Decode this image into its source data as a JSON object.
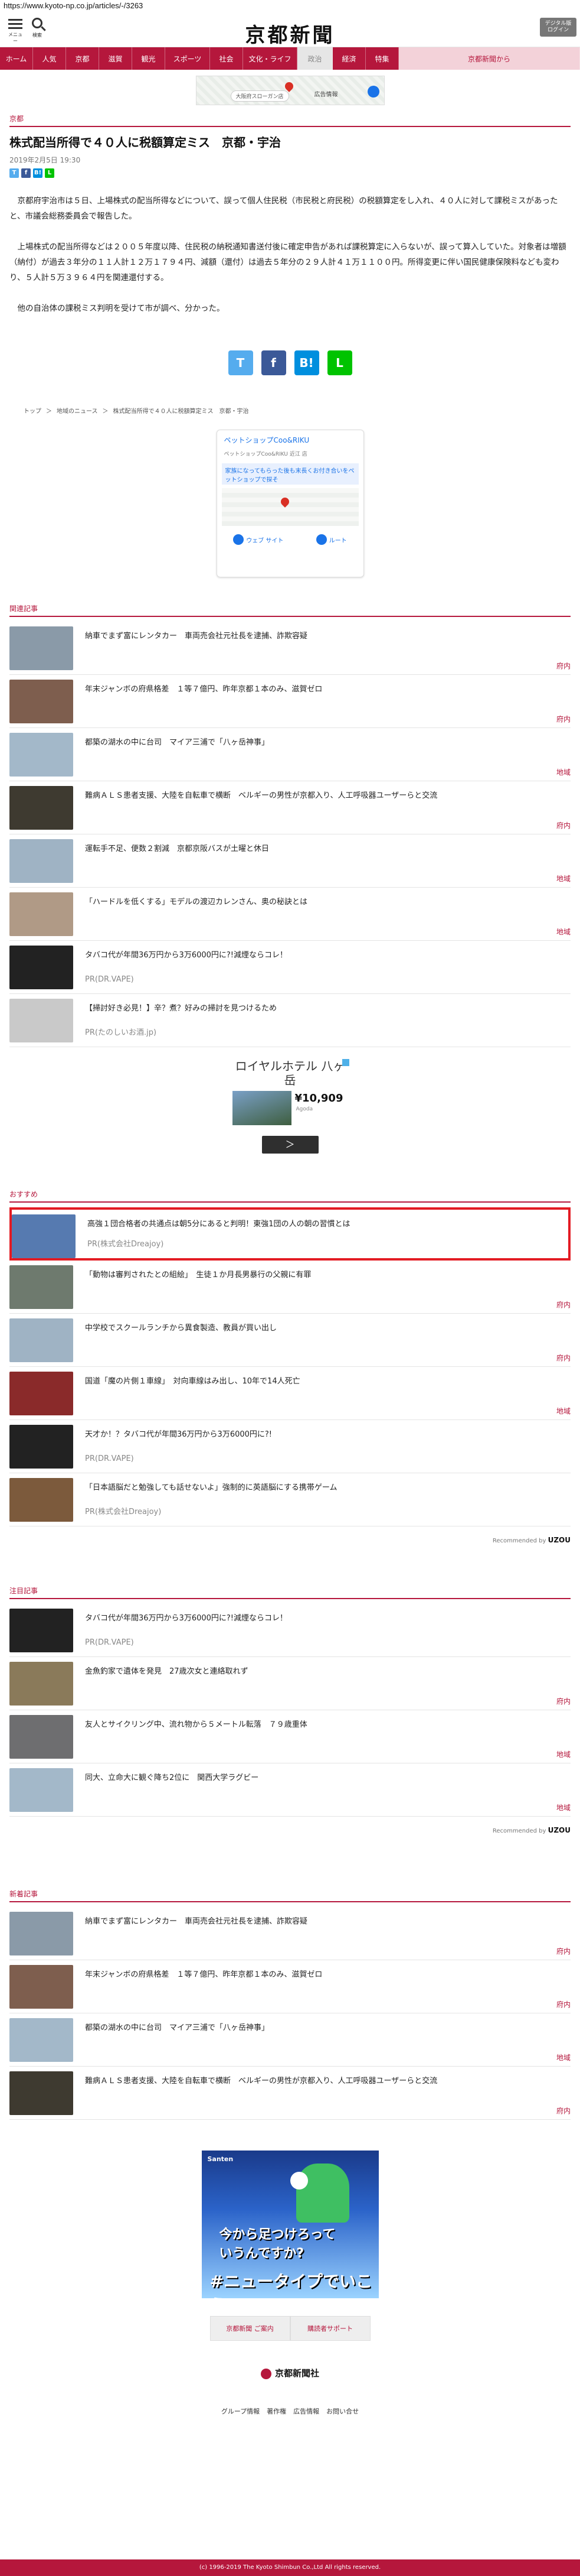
{
  "url": "https://www.kyoto-np.co.jp/articles/-/3263",
  "header": {
    "menu_label": "メニュー",
    "search_label": "検索",
    "logo": "京都新聞",
    "digital_button": "デジタル版 ログイン"
  },
  "nav": {
    "items": [
      "ホーム",
      "人気",
      "京都",
      "滋賀",
      "観光",
      "スポーツ",
      "社会",
      "文化・ライフ",
      "政治",
      "経済",
      "特集",
      "京都新聞から"
    ],
    "active_index": 8
  },
  "top_ad": {
    "badge": "大阪府スローガン店",
    "text": "広告情報"
  },
  "article": {
    "section": "京都",
    "title": "株式配当所得で４０人に税額算定ミス　京都・宇治",
    "date": "2019年2月5日 19:30",
    "paragraphs": [
      "京都府宇治市は５日、上場株式の配当所得などについて、誤って個人住民税（市民税と府民税）の税額算定をし入れ、４０人に対して課税ミスがあったと、市議会総務委員会で報告した。",
      "上場株式の配当所得などは２００５年度以降、住民税の納税通知書送付後に確定申告があれば課税算定に入らないが、誤って算入していた。対象者は増額（納付）が過去３年分の１１人計１２万１７９４円、減額（還付）は過去５年分の２９人計４１万１１００円。所得変更に伴い国民健康保険料なども変わり、５人計５万３９６４円を関連還付する。",
      "他の自治体の課税ミス判明を受けて市が調べ、分かった。"
    ],
    "share_small": [
      "T",
      "f",
      "B!",
      "L"
    ],
    "share_big": [
      "T",
      "f",
      "B!",
      "L"
    ]
  },
  "breadcrumb": [
    "トップ",
    "＞",
    "地域のニュース",
    "＞",
    "株式配当所得で４０人に税額算定ミス　京都・宇治"
  ],
  "map_ad": {
    "name": "ペットショップCoo&RIKU",
    "sub": "ペットショップCoo&RIKU 近江 店",
    "blue_text": "家族になってもらった後も末長くお付き合いをペットショップで探そ",
    "btn_web": "ウェブ サイト",
    "btn_route": "ルート"
  },
  "related": {
    "label": "関連記事",
    "items": [
      {
        "title": "納車でまず富にレンタカー　車両売会社元社長を逮捕、詐欺容疑",
        "category": "府内",
        "thumb": "#8a9aa8"
      },
      {
        "title": "年末ジャンボの府県格差　１等７億円、昨年京都１本のみ、滋賀ゼロ",
        "category": "府内",
        "thumb": "#7e5e4e"
      },
      {
        "title": "都築の湖水の中に台司　マイア三浦で「八ヶ岳神事」",
        "category": "地域",
        "thumb": "#a3b8c9"
      },
      {
        "title": "難病ＡＬＳ患者支援、大陸を自転車で横断　ベルギーの男性が京都入り、人工呼吸器ユーザーらと交流",
        "category": "府内",
        "thumb": "#3e3a30"
      },
      {
        "title": "運転手不足、便数２割減　京都京阪バスが土曜と休日",
        "category": "地域",
        "thumb": "#9fb3c4"
      },
      {
        "title": "「ハードルを低くする」モデルの渡辺カレンさん、奥の秘訣とは",
        "category": "地域",
        "thumb": "#b09a86"
      },
      {
        "title": "タバコ代が年間36万円から3万6000円に?!減煙ならコレ！",
        "pr": "PR(DR.VAPE)",
        "thumb": "#222222"
      },
      {
        "title": "【掃討好き必見！】辛？煮？好みの掃討を見つけるため",
        "pr": "PR(たのしいお酒.jp)",
        "thumb": "#c9c9c9"
      }
    ]
  },
  "hotel_ad": {
    "name": "ロイヤルホテル 八ヶ岳",
    "price": "¥10,909",
    "src": "Agoda",
    "go": "＞"
  },
  "recommend": {
    "label": "おすすめ",
    "items": [
      {
        "title": "高強１団合格者の共通点は朝5分にあると判明！東強1団の人の朝の習慣とは",
        "pr": "PR(株式会社Dreajoy)",
        "thumb": "#567ab0",
        "highlight": true
      },
      {
        "title": "「動物は審判されたとの組絵」　生徒１か月長男暴行の父親に有罪",
        "category": "府内",
        "thumb": "#6e7a6e"
      },
      {
        "title": "中学校でスクールランチから異食製造、教員が買い出し",
        "category": "府内",
        "thumb": "#9fb3c4"
      },
      {
        "title": "国道「魔の片側１車線」　対向車線はみ出し、10年で14人死亡",
        "category": "地域",
        "thumb": "#8a2a2a"
      },
      {
        "title": "天才か！？タバコ代が年間36万円から3万6000円に?!",
        "pr": "PR(DR.VAPE)",
        "thumb": "#222222"
      },
      {
        "title": "「日本語脳だと勉強しても話せないよ」強制的に英語脳にする携帯ゲーム",
        "pr": "PR(株式会社Dreajoy)",
        "thumb": "#7c5a3c"
      }
    ],
    "credit_prefix": "Recommended by",
    "credit_brand": "UZOU"
  },
  "attention": {
    "label": "注目記事",
    "items": [
      {
        "title": "タバコ代が年間36万円から3万6000円に?!減煙ならコレ！",
        "pr": "PR(DR.VAPE)",
        "thumb": "#222222"
      },
      {
        "title": "金魚釣家で遺体を発見　27歳次女と連絡取れず",
        "category": "府内",
        "thumb": "#8a7a5a"
      },
      {
        "title": "友人とサイクリング中、流れ物から５メートル転落　７９歳重体",
        "category": "地域",
        "thumb": "#6e6e70"
      },
      {
        "title": "同大、立命大に観ぐ降ち2位に　関西大学ラグビー",
        "category": "地域",
        "thumb": "#a3b8c9"
      }
    ],
    "credit_prefix": "Recommended by",
    "credit_brand": "UZOU"
  },
  "latest": {
    "label": "新着記事",
    "items": [
      {
        "title": "納車でまず富にレンタカー　車両売会社元社長を逮捕、詐欺容疑",
        "category": "府内",
        "thumb": "#8a9aa8"
      },
      {
        "title": "年末ジャンボの府県格差　１等７億円、昨年京都１本のみ、滋賀ゼロ",
        "category": "府内",
        "thumb": "#7e5e4e"
      },
      {
        "title": "都築の湖水の中に台司　マイア三浦で「八ヶ岳神事」",
        "category": "地域",
        "thumb": "#a3b8c9"
      },
      {
        "title": "難病ＡＬＳ患者支援、大陸を自転車で横断　ベルギーの男性が京都入り、人工呼吸器ユーザーらと交流",
        "category": "府内",
        "thumb": "#3e3a30"
      }
    ]
  },
  "big_ad": {
    "brand": "Santen",
    "line1": "今から足つけろって",
    "line2": "いうんですか?",
    "line3": "#ニュータイプでいこう"
  },
  "footer": {
    "buttons": [
      "京都新聞 ご案内",
      "購読者サポート"
    ],
    "logo": "京都新聞社",
    "links": [
      "グループ情報",
      "著作権",
      "広告情報",
      "お問い合せ"
    ],
    "copyright": "(c) 1996-2019 The Kyoto Shimbun Co.,Ltd All rights reserved."
  },
  "colors": {
    "brand": "#b5173c",
    "highlight_border": "#e31b23",
    "twitter": "#55acee",
    "facebook": "#3b5998",
    "hatena": "#008fde",
    "line": "#00c300"
  }
}
